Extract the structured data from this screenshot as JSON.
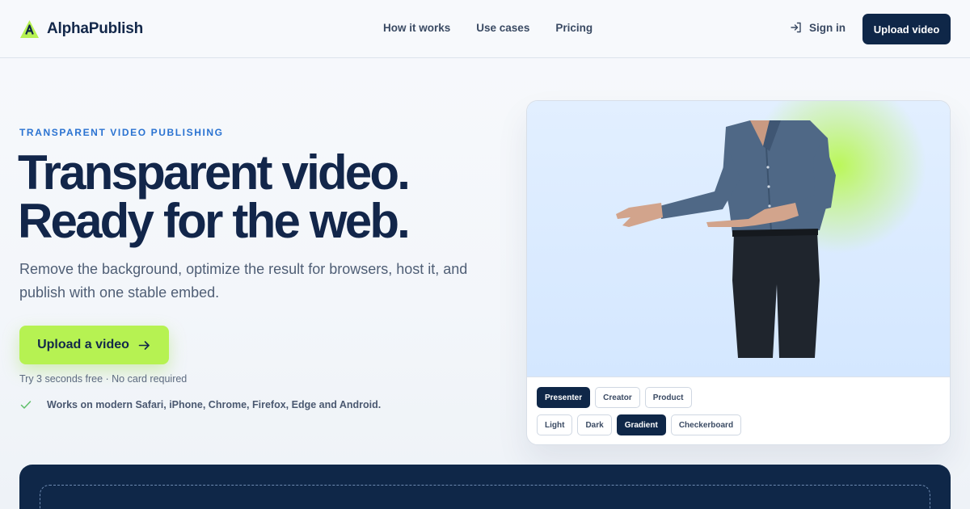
{
  "brand": {
    "name": "AlphaPublish",
    "accent": "#b6f252",
    "navy": "#0f2748"
  },
  "nav": {
    "items": [
      "How it works",
      "Use cases",
      "Pricing"
    ]
  },
  "header": {
    "sign_in": "Sign in",
    "upload_button": "Upload video"
  },
  "hero": {
    "eyebrow": "TRANSPARENT VIDEO PUBLISHING",
    "headline_line1": "Transparent video.",
    "headline_line2": "Ready for the web.",
    "subtitle": "Remove the background, optimize the result for browsers, host it, and publish with one stable embed.",
    "cta": "Upload a video",
    "trial_note": "Try 3 seconds free · No card required",
    "compat_note": "Works on modern Safari, iPhone, Chrome, Firefox, Edge and Android."
  },
  "preview": {
    "subjects": [
      {
        "label": "Presenter",
        "active": true
      },
      {
        "label": "Creator",
        "active": false
      },
      {
        "label": "Product",
        "active": false
      }
    ],
    "backgrounds": [
      {
        "label": "Light",
        "active": false
      },
      {
        "label": "Dark",
        "active": false
      },
      {
        "label": "Gradient",
        "active": true
      },
      {
        "label": "Checkerboard",
        "active": false
      }
    ]
  },
  "icons": {
    "logo": "logo-a-icon",
    "sign_in": "sign-in-icon",
    "cta_arrow": "arrow-right-icon",
    "compat": "check-icon"
  }
}
